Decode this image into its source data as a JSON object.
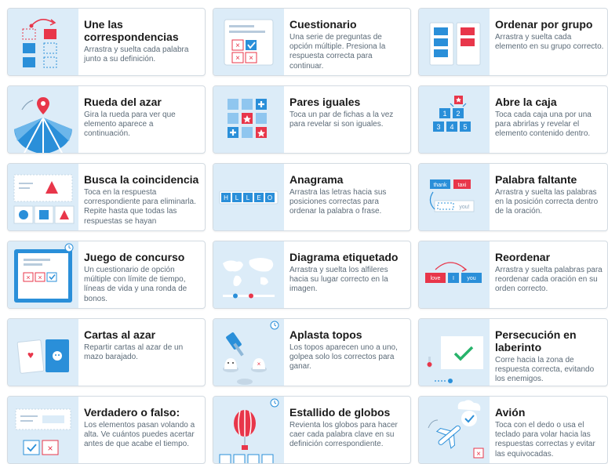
{
  "colors": {
    "thumb_bg": "#dcecf8",
    "accent_blue": "#2a8fd9",
    "accent_red": "#e8364a",
    "accent_green": "#27b36b",
    "title": "#1a1a1a",
    "desc": "#5c6b78"
  },
  "templates": [
    {
      "id": "une",
      "title": "Une las correspondencias",
      "desc": "Arrastra y suelta cada palabra junto a su definición.",
      "icon": "match-pairs-icon"
    },
    {
      "id": "cuest",
      "title": "Cuestionario",
      "desc": "Una serie de preguntas de opción múltiple. Presiona la respuesta correcta para continuar.",
      "icon": "quiz-icon"
    },
    {
      "id": "ordenar",
      "title": "Ordenar por grupo",
      "desc": "Arrastra y suelta cada elemento en su grupo correcto.",
      "icon": "group-sort-icon"
    },
    {
      "id": "rueda",
      "title": "Rueda del azar",
      "desc": "Gira la rueda para ver que elemento aparece a continuación.",
      "icon": "spin-wheel-icon"
    },
    {
      "id": "pares",
      "title": "Pares iguales",
      "desc": "Toca un par de fichas a la vez para revelar si son iguales.",
      "icon": "matching-tiles-icon"
    },
    {
      "id": "caja",
      "title": "Abre la caja",
      "desc": "Toca cada caja una por una para abrirlas y revelar el elemento contenido dentro.",
      "icon": "open-box-icon"
    },
    {
      "id": "busca",
      "title": "Busca la coincidencia",
      "desc": "Toca en la respuesta correspondiente para eliminarla. Repite hasta que todas las respuestas se hayan",
      "icon": "find-match-icon"
    },
    {
      "id": "anagrama",
      "title": "Anagrama",
      "desc": "Arrastra las letras hacia sus posiciones correctas para ordenar la palabra o frase.",
      "icon": "anagram-icon",
      "letters": [
        "H",
        "L",
        "L",
        "E",
        "O"
      ]
    },
    {
      "id": "palabra",
      "title": "Palabra faltante",
      "desc": "Arrastra y suelta las palabras en la posición correcta dentro de la oración.",
      "icon": "missing-word-icon",
      "words": [
        "thank",
        "taxi",
        "you!"
      ]
    },
    {
      "id": "juego",
      "title": "Juego de concurso",
      "desc": "Un cuestionario de opción múltiple con límite de tiempo, líneas de vida y una ronda de bonos.",
      "icon": "gameshow-icon"
    },
    {
      "id": "diagrama",
      "title": "Diagrama etiquetado",
      "desc": "Arrastra y suelta los alfileres hacia su lugar correcto en la imagen.",
      "icon": "labelled-diagram-icon"
    },
    {
      "id": "reordenar",
      "title": "Reordenar",
      "desc": "Arrastra y suelta palabras para reordenar cada oración en su orden correcto.",
      "icon": "unjumble-icon",
      "words": [
        "love",
        "I",
        "you"
      ]
    },
    {
      "id": "cartas",
      "title": "Cartas al azar",
      "desc": "Repartir cartas al azar de un mazo barajado.",
      "icon": "random-cards-icon"
    },
    {
      "id": "topos",
      "title": "Aplasta topos",
      "desc": "Los topos aparecen uno a uno, golpea solo los correctos para ganar.",
      "icon": "whack-a-mole-icon"
    },
    {
      "id": "laberinto",
      "title": "Persecución en laberinto",
      "desc": "Corre hacia la zona de respuesta correcta, evitando los enemigos.",
      "icon": "maze-chase-icon"
    },
    {
      "id": "verdadero",
      "title": "Verdadero o falso:",
      "desc": "Los elementos pasan volando a alta. Ve cuántos puedes acertar antes de que acabe el tiempo.",
      "icon": "true-false-icon"
    },
    {
      "id": "globos",
      "title": "Estallido de globos",
      "desc": "Revienta los globos para hacer caer cada palabra clave en su definición correspondiente.",
      "icon": "balloon-pop-icon"
    },
    {
      "id": "avion",
      "title": "Avión",
      "desc": "Toca con el dedo o usa el teclado para volar hacia las respuestas correctas y evitar las equivocadas.",
      "icon": "airplane-icon"
    }
  ]
}
